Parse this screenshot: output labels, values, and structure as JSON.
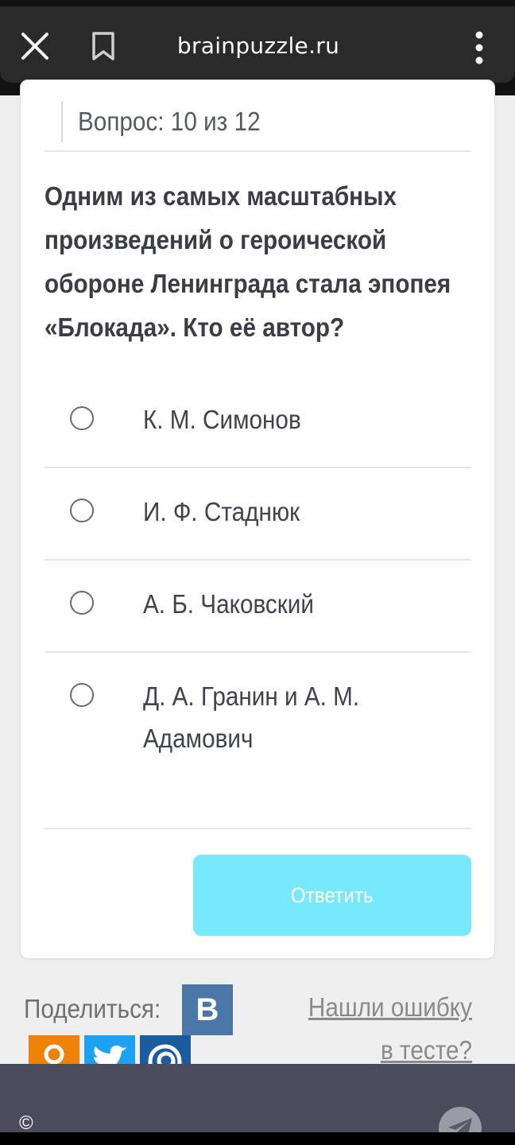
{
  "browser": {
    "url": "brainpuzzle.ru",
    "close_icon": "close-icon",
    "bookmark_icon": "bookmark-icon",
    "menu_icon": "more-vert-icon"
  },
  "quiz": {
    "counter": "Вопрос: 10 из 12",
    "question_lines": [
      "Одним из самых масштабных",
      "произведений о героической",
      "обороне Ленинграда стала эпопея",
      "«Блокада». Кто её автор?"
    ],
    "options": [
      {
        "lines": [
          "К. М. Симонов"
        ]
      },
      {
        "lines": [
          "И. Ф. Стаднюк"
        ]
      },
      {
        "lines": [
          "А. Б. Чаковский"
        ]
      },
      {
        "lines": [
          "Д. А. Гранин и А. М.",
          "Адамович"
        ]
      }
    ],
    "answer_label": "Ответить"
  },
  "share": {
    "label": "Поделиться:",
    "vk_letter": "В",
    "networks": [
      "vk-icon",
      "odnoklassniki-icon",
      "twitter-icon",
      "mail-icon"
    ],
    "error_link_lines": [
      "Нашли ошибку",
      "в тесте?"
    ]
  },
  "footer": {
    "copyright": "©",
    "telegram_icon": "telegram-icon"
  },
  "colors": {
    "answer_button": "#77e9fb",
    "footer": "#4a4c5c",
    "vk": "#4a76a8",
    "odnoklassniki": "#ee8208",
    "twitter": "#1da1f2",
    "mail": "#1a5c9e"
  }
}
